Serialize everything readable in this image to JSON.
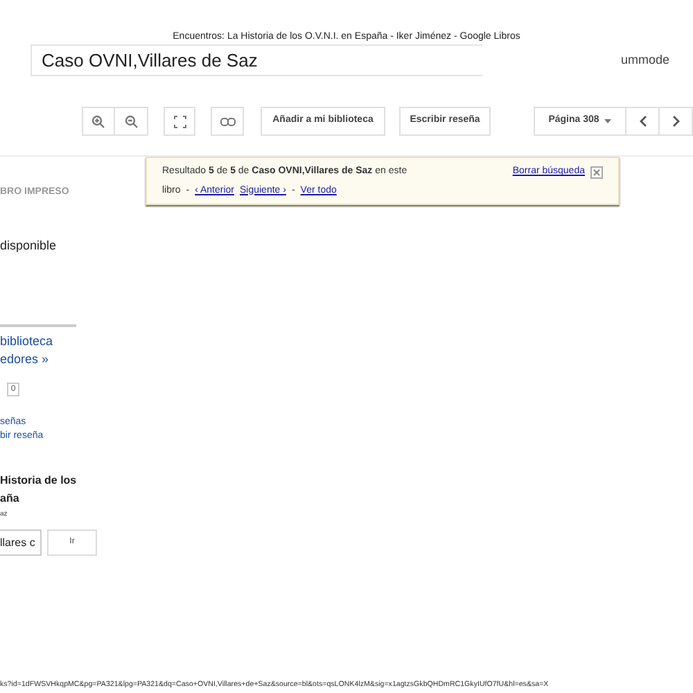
{
  "page_title": "Encuentros: La Historia de los O.V.N.I. en España - Iker Jiménez - Google Libros",
  "search": {
    "value": "Caso OVNI,Villares de Saz"
  },
  "account": "ummode",
  "toolbar": {
    "buttons": [
      "Añadir a mi biblioteca",
      "Escribir reseña"
    ],
    "page_select": "Página 308"
  },
  "search_result": {
    "summary": "Resultado **5** de **5** de **Caso OVNI,Villares de Saz** en este",
    "parts": [
      {
        "kind": "text",
        "text": "libro"
      },
      {
        "kind": "text",
        "text": "-"
      },
      {
        "kind": "link",
        "text": "‹ Anterior"
      },
      {
        "kind": "link",
        "text": "Siguiente ›"
      },
      {
        "kind": "text",
        "text": "-"
      },
      {
        "kind": "link",
        "text": "Ver todo"
      }
    ],
    "clear": "Borrar búsqueda"
  },
  "sidebar": {
    "heading": "BRO IMPRESO",
    "availability": "disponible",
    "links": [
      "biblioteca",
      "edores »"
    ],
    "count": "0",
    "review_links": [
      "señas",
      "bir reseña"
    ],
    "book_title": [
      "Historia de los",
      "aña"
    ],
    "author": "az",
    "search_value": "llares c",
    "go_button": "Ir"
  },
  "status_url": "ks?id=1dFWSVHkqpMC&pg=PA321&lpg=PA321&dq=Caso+OVNI,Villares+de+Saz&source=bl&ots=qsLONK4lzM&sig=x1agtzsGkbQHDmRC1GkyIUfO7fU&hl=es&sa=X"
}
